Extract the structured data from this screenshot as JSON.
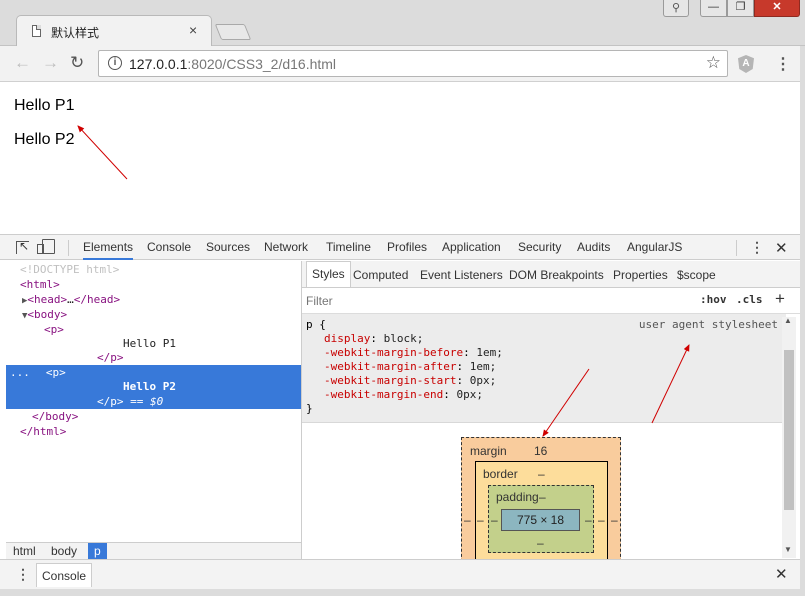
{
  "window": {
    "tab_title": "默认样式",
    "tab_close": "×",
    "user_icon": "user-icon",
    "min_label": "—",
    "max_label": "❐",
    "close_label": "✕"
  },
  "toolbar": {
    "back": "←",
    "forward": "→",
    "reload": "↻",
    "url_host": "127.0.0.1",
    "url_path": ":8020/CSS3_2/d16.html",
    "star": "☆",
    "ext_letter": "A",
    "menu": "⋮"
  },
  "page": {
    "p1": "Hello P1",
    "p2": "Hello P2"
  },
  "devtools": {
    "tabs": [
      "Elements",
      "Console",
      "Sources",
      "Network",
      "Timeline",
      "Profiles",
      "Application",
      "Security",
      "Audits",
      "AngularJS"
    ],
    "active_tab": "Elements",
    "menu": "⋮",
    "close": "✕",
    "dom": {
      "doctype": "<!DOCTYPE html>",
      "html_open": "<html>",
      "head_open": "<head>",
      "head_ellipsis": "…",
      "head_close": "</head>",
      "body_open": "<body>",
      "p_open": "<p>",
      "p1_text": "Hello P1",
      "p_close": "</p>",
      "p2_text": "Hello P2",
      "selected_marker": "== $0",
      "dots": "...",
      "body_close": "</body>",
      "html_close": "</html>"
    },
    "breadcrumbs": [
      "html",
      "body",
      "p"
    ],
    "styles_tabs": [
      "Styles",
      "Computed",
      "Event Listeners",
      "DOM Breakpoints",
      "Properties",
      "$scope"
    ],
    "filter_placeholder": "Filter",
    "hov": ":hov",
    "cls": ".cls",
    "add": "+",
    "rule": {
      "selector": "p {",
      "source": "user agent stylesheet",
      "props": [
        {
          "name": "display",
          "value": "block;"
        },
        {
          "name": "-webkit-margin-before",
          "value": "1em;"
        },
        {
          "name": "-webkit-margin-after",
          "value": "1em;"
        },
        {
          "name": "-webkit-margin-start",
          "value": "0px;"
        },
        {
          "name": "-webkit-margin-end",
          "value": "0px;"
        }
      ],
      "close": "}"
    },
    "box_model": {
      "margin_label": "margin",
      "margin_top": "16",
      "border_label": "border",
      "border_value": "–",
      "padding_label": "padding",
      "padding_value": "–",
      "padding_bottom": "–",
      "side_dash": "–",
      "content": "775 × 18"
    },
    "drawer": {
      "menu": "⋮",
      "tab": "Console",
      "close": "✕"
    }
  },
  "colors": {
    "accent": "#3879d9",
    "annotation_arrow": "#d00000",
    "tag": "#881280",
    "css_property": "#c80000"
  }
}
